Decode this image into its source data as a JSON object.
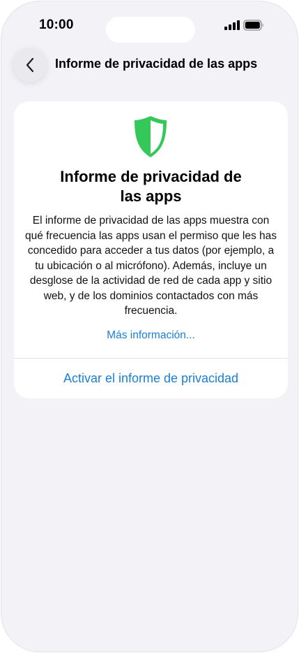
{
  "status_bar": {
    "time": "10:00"
  },
  "nav": {
    "title": "Informe de privacidad de las apps",
    "back_icon": "chevron-left-icon"
  },
  "card": {
    "icon": "shield-icon",
    "title": "Informe de privacidad de las apps",
    "body": "El informe de privacidad de las apps muestra con qué frecuencia las apps usan el permiso que les has concedido para acceder a tus datos (por ejemplo, a tu ubicación o al micrófono). Además, incluye un desglose de la actividad de red de cada app y sitio web, y de los dominios contactados con más frecuencia.",
    "more_info_label": "Más información...",
    "activate_label": "Activar el informe de privacidad"
  },
  "colors": {
    "accent": "#1a7fd4",
    "shield": "#34c759",
    "background": "#f2f2f7"
  }
}
